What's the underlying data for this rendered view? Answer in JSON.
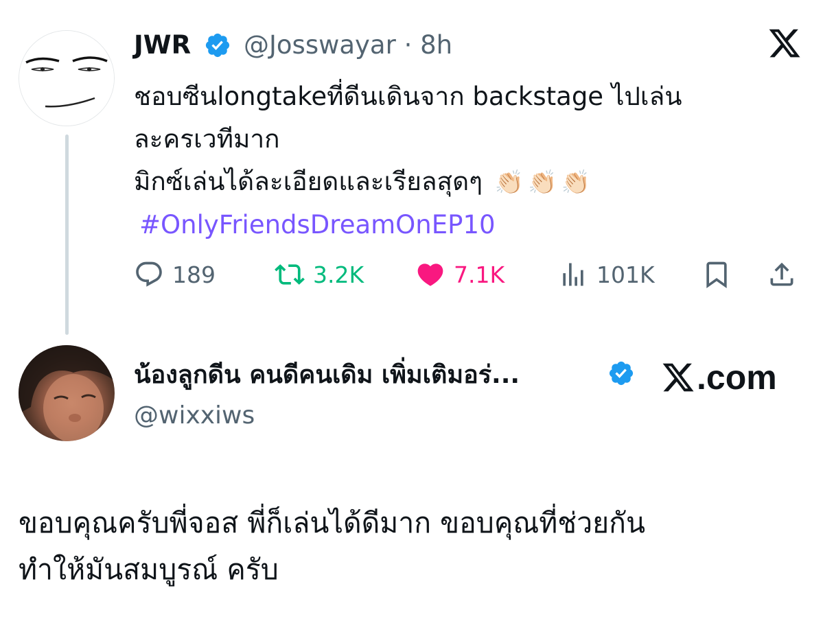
{
  "original_tweet": {
    "author_name": "JWR",
    "verified": true,
    "handle": "@Josswayar",
    "separator": "·",
    "time": "8h",
    "text_lines": [
      "ชอบซีนlongtakeที่ดีนเดินจาก backstage ไปเล่น",
      "ละครเวทีมาก",
      "มิกซ์เล่นได้ละเอียดและเรียลสุดๆ"
    ],
    "emojis": [
      "👏🏻",
      "👏🏻",
      "👏🏻"
    ],
    "hashtag": "#OnlyFriendsDreamOnEP10",
    "stats": {
      "replies": "189",
      "retweets": "3.2K",
      "likes": "7.1K",
      "views": "101K"
    }
  },
  "reply": {
    "author_name": "น้องลูกดีน คนดีคนเดิม เพิ่มเติมอร่...",
    "verified": true,
    "handle": "@wixxiws",
    "source_label": ".com",
    "text_lines": [
      "ขอบคุณครับพี่จอส พี่ก็เล่นได้ดีมาก ขอบคุณที่ช่วยกัน",
      "ทำให้มันสมบูรณ์ ครับ"
    ]
  },
  "colors": {
    "text": "#0f1419",
    "secondary": "#536471",
    "verified": "#1d9bf0",
    "retweet": "#00ba7c",
    "like": "#f91880",
    "hashtag": "#7856ff",
    "thread_line": "#cfd9de"
  },
  "icons": [
    "x-logo-icon",
    "verified-badge-icon",
    "reply-icon",
    "retweet-icon",
    "like-icon",
    "views-icon",
    "bookmark-icon",
    "share-icon"
  ]
}
